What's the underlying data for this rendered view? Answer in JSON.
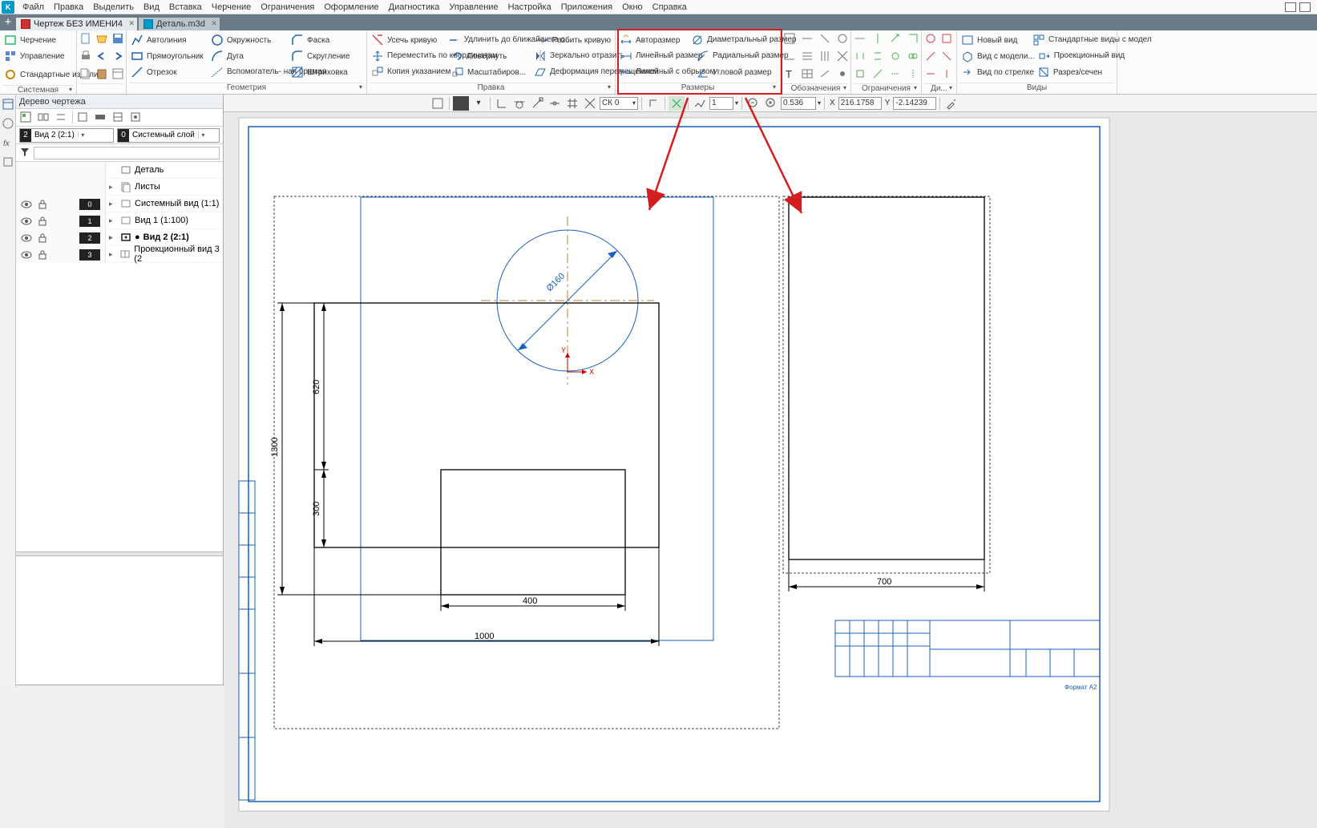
{
  "menubar": {
    "items": [
      "Файл",
      "Правка",
      "Выделить",
      "Вид",
      "Вставка",
      "Черчение",
      "Ограничения",
      "Оформление",
      "Диагностика",
      "Управление",
      "Настройка",
      "Приложения",
      "Окно",
      "Справка"
    ]
  },
  "tabs": {
    "active": "Чертеж БЕЗ ИМЕНИ4",
    "inactive": "Деталь.m3d"
  },
  "ribbon": {
    "group_left": {
      "btn1": "Черчение",
      "btn2": "Управление",
      "btn3": "Стандартные изделия",
      "footer": "Системная"
    },
    "group_geom": {
      "r1": [
        "Автолиния",
        "Окружность",
        "Фаска"
      ],
      "r2": [
        "Прямоугольник",
        "Дуга",
        "Скругление"
      ],
      "r3": [
        "Отрезок",
        "Вспомогатель- ная прямая",
        "Штриховка"
      ],
      "footer": "Геометрия"
    },
    "group_edit": {
      "r1": [
        "Усечь кривую",
        "Удлинить до ближайшего о...",
        "Разбить кривую"
      ],
      "r2": [
        "Переместить по координатам",
        "Повернуть",
        "Зеркально отразить"
      ],
      "r3": [
        "Копия указанием",
        "Масштабиров...",
        "Деформация перемещением"
      ],
      "footer": "Правка"
    },
    "group_dims": {
      "r1": [
        "Авторазмер",
        "Диаметральный размер"
      ],
      "r2": [
        "Линейный размер",
        "Радиальный размер"
      ],
      "r3": [
        "Линейный с обрывом",
        "Угловой размер"
      ],
      "footer": "Размеры"
    },
    "group_notes": {
      "footer": "Обозначения"
    },
    "group_constr": {
      "footer": "Ограничения"
    },
    "group_diag": {
      "footer": "Ди..."
    },
    "group_views": {
      "r1": "Новый вид",
      "r2": "Вид с модели...",
      "r3": "Вид по стрелке",
      "r1b": "Стандартные виды с модел",
      "r2b": "Проекционный вид",
      "r3b": "Разрез/сечен",
      "footer": "Виды"
    }
  },
  "toolbar2": {
    "ck": "СК 0",
    "step": "1",
    "scale": "0.536",
    "x_label": "X",
    "x_val": "216.1758",
    "y_label": "Y",
    "y_val": "-2.14239"
  },
  "tree": {
    "title": "Дерево чертежа",
    "combo_view": {
      "badge": "2",
      "text": "Вид 2 (2:1)"
    },
    "combo_layer": {
      "badge": "0",
      "text": "Системный слой"
    },
    "filter_placeholder": "",
    "root": "Деталь",
    "n_sheets": "Листы",
    "rows": [
      {
        "num": "0",
        "label": "Системный вид (1:1)"
      },
      {
        "num": "1",
        "label": "Вид 1 (1:100)"
      },
      {
        "num": "2",
        "label": "Вид 2 (2:1)",
        "bold": true
      },
      {
        "num": "3",
        "label": "Проекционный вид 3 (2"
      }
    ]
  },
  "drawing": {
    "circle_dim": "Ø160",
    "dim_h_bottom": "1000",
    "dim_h_mid": "400",
    "dim_v_left": "1300",
    "dim_v_mid": "620",
    "dim_v_small": "300",
    "right_dim": "700",
    "title_hint": "Формат  А2"
  }
}
